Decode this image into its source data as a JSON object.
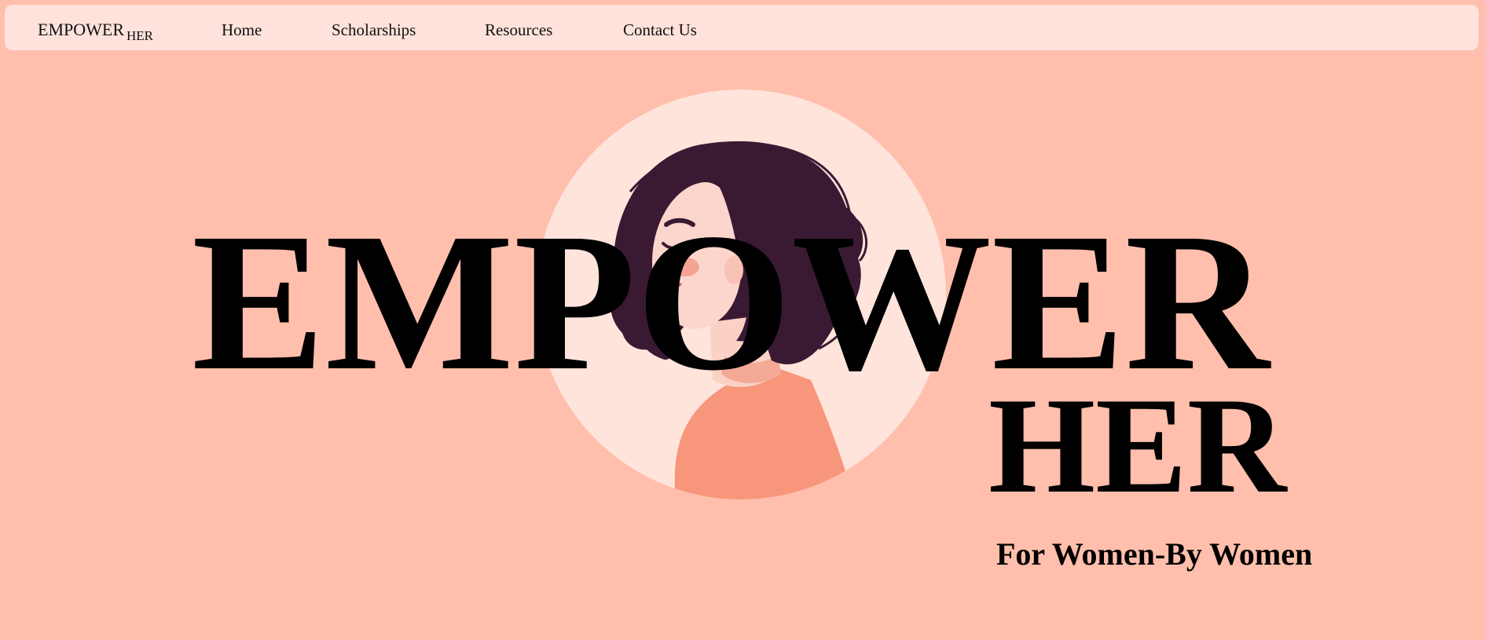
{
  "navbar": {
    "brand_main": "EMPOWER",
    "brand_sub": "HER",
    "links": [
      "Home",
      "Scholarships",
      "Resources",
      "Contact Us"
    ]
  },
  "hero": {
    "title_main": "EMPOWER",
    "title_sub": "HER",
    "tagline": "For Women-By Women",
    "illustration": "woman-portrait-illustration"
  },
  "colors": {
    "background": "#ffbfac",
    "navbar": "#ffe2db",
    "circle": "#ffe4dc",
    "hair": "#3a1a33",
    "skin": "#fcd6cc",
    "shirt": "#f7967a"
  }
}
